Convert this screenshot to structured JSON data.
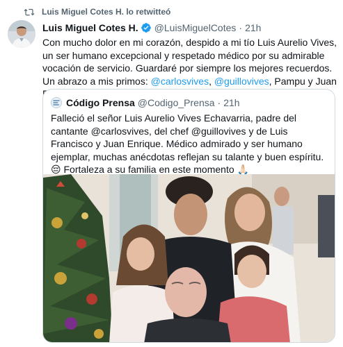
{
  "retweet": {
    "icon": "retweet-icon",
    "text": "Luis Miguel Cotes H. lo retwitteó"
  },
  "tweet": {
    "display_name": "Luis Miguel Cotes H.",
    "verified_icon": "verified-badge-icon",
    "handle": "@LuisMiguelCotes",
    "separator": "·",
    "time": "21h",
    "text_before": "Con mucho dolor en mi corazón, despido a mi tío Luis Aurelio Vives, un ser humano excepcional y respetado médico por su admirable vocación de servicio. Guardaré por siempre los mejores recuerdos. Un abrazo a mis primos: ",
    "mention_1": "@carlosvives",
    "comma": ", ",
    "mention_2": "@guillovives",
    "text_after": ", Pampu y Juan Enrique"
  },
  "quote": {
    "display_name": "Código Prensa",
    "handle": "@Codigo_Prensa",
    "separator": "·",
    "time": "21h",
    "text_1": "Falleció el señor Luis Aurelio Vives Echavarria, padre del cantante @carlosvives, del chef @guillovives y de Luis Francisco y Juan Enrique. Médico admirado y ser humano ejemplar, muchas anécdotas reflejan su talante y buen espíritu. ",
    "emoji_1": "😔",
    "text_2": " Fortaleza a su familia en este momento ",
    "emoji_2": "🙏🏻",
    "photo_icon": "family-photo"
  },
  "colors": {
    "link": "#1d9bf0",
    "secondary_text": "#536471",
    "border": "#cfd9de",
    "verified": "#1d9bf0"
  }
}
